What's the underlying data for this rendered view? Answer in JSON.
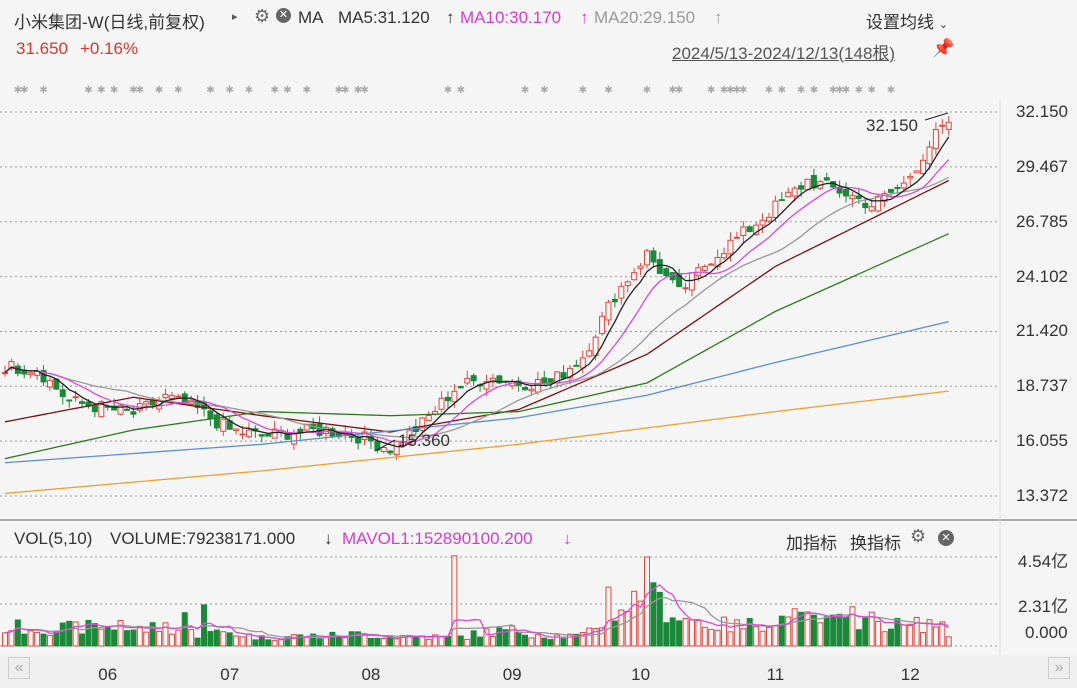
{
  "header": {
    "title": "小米集团-W(日线,前复权)",
    "ma_label": "MA",
    "ma5": "MA5:31.120",
    "ma10": "MA10:30.170",
    "ma20": "MA20:29.150",
    "arrow_up": "↑",
    "settings_ma": "设置均线",
    "price": "31.650",
    "change": "+0.16%",
    "range": "2024/5/13-2024/12/13(148根)"
  },
  "colors": {
    "up": "#e0473e",
    "down": "#1a8a3a",
    "ma5": "#222222",
    "ma10": "#d84ad8",
    "ma20": "#999999",
    "ma30": "#7a1010",
    "ma60": "#2f7a1f",
    "ma120": "#5b8fd6",
    "ma250": "#f0a030",
    "accent": "#d13fcf"
  },
  "volume_panel": {
    "title": "VOL(5,10)",
    "volume": "VOLUME:79238171.000",
    "arrow_down": "↓",
    "mavol": "MAVOL1:152890100.200",
    "add_indicator": "加指标",
    "switch_indicator": "换指标",
    "ticks": [
      "4.54亿",
      "2.31亿",
      "0.000"
    ]
  },
  "annotations": {
    "high": "32.150",
    "low": "15.360"
  },
  "nav": {
    "prev": "«",
    "next": "»"
  },
  "chart_data": {
    "type": "candlestick",
    "count": 148,
    "y_ticks": [
      "32.150",
      "29.467",
      "26.785",
      "24.102",
      "21.420",
      "18.737",
      "16.055",
      "13.372"
    ],
    "ylim": [
      13.372,
      32.15
    ],
    "x_labels": [
      {
        "label": "06",
        "index": 16
      },
      {
        "label": "07",
        "index": 35
      },
      {
        "label": "08",
        "index": 57
      },
      {
        "label": "09",
        "index": 79
      },
      {
        "label": "10",
        "index": 99
      },
      {
        "label": "11",
        "index": 120
      },
      {
        "label": "12",
        "index": 141
      }
    ],
    "close_keypoints": [
      [
        0,
        19.7
      ],
      [
        5,
        19.6
      ],
      [
        10,
        18.0
      ],
      [
        15,
        17.7
      ],
      [
        20,
        17.4
      ],
      [
        25,
        18.2
      ],
      [
        30,
        17.6
      ],
      [
        35,
        16.6
      ],
      [
        40,
        16.3
      ],
      [
        45,
        16.5
      ],
      [
        50,
        16.6
      ],
      [
        55,
        16.3
      ],
      [
        60,
        15.7
      ],
      [
        65,
        16.9
      ],
      [
        70,
        18.6
      ],
      [
        75,
        19.2
      ],
      [
        80,
        18.9
      ],
      [
        85,
        18.9
      ],
      [
        90,
        20.2
      ],
      [
        95,
        23.2
      ],
      [
        100,
        25.2
      ],
      [
        105,
        23.3
      ],
      [
        110,
        25.0
      ],
      [
        115,
        26.2
      ],
      [
        120,
        27.5
      ],
      [
        125,
        28.8
      ],
      [
        130,
        28.3
      ],
      [
        135,
        27.6
      ],
      [
        140,
        28.6
      ],
      [
        145,
        31.0
      ],
      [
        147,
        31.65
      ]
    ],
    "ma_long_keypoints": {
      "ma30": [
        [
          0,
          17.0
        ],
        [
          20,
          18.2
        ],
        [
          40,
          17.3
        ],
        [
          60,
          16.5
        ],
        [
          80,
          17.6
        ],
        [
          100,
          20.3
        ],
        [
          120,
          24.6
        ],
        [
          147,
          28.8
        ]
      ],
      "ma60": [
        [
          0,
          15.2
        ],
        [
          20,
          16.6
        ],
        [
          40,
          17.5
        ],
        [
          60,
          17.3
        ],
        [
          80,
          17.5
        ],
        [
          100,
          18.9
        ],
        [
          120,
          22.4
        ],
        [
          147,
          26.2
        ]
      ],
      "ma120": [
        [
          0,
          15.0
        ],
        [
          40,
          15.9
        ],
        [
          80,
          17.2
        ],
        [
          100,
          18.3
        ],
        [
          120,
          19.9
        ],
        [
          147,
          21.9
        ]
      ],
      "ma250": [
        [
          0,
          13.5
        ],
        [
          40,
          14.6
        ],
        [
          80,
          15.9
        ],
        [
          100,
          16.7
        ],
        [
          120,
          17.5
        ],
        [
          147,
          18.5
        ]
      ]
    },
    "volume_keypoints": [
      [
        0,
        1.0
      ],
      [
        5,
        0.9
      ],
      [
        10,
        0.9
      ],
      [
        15,
        1.0
      ],
      [
        20,
        0.8
      ],
      [
        25,
        1.0
      ],
      [
        30,
        0.6
      ],
      [
        35,
        0.7
      ],
      [
        40,
        0.4
      ],
      [
        45,
        0.5
      ],
      [
        50,
        0.5
      ],
      [
        55,
        0.6
      ],
      [
        60,
        0.5
      ],
      [
        65,
        0.5
      ],
      [
        70,
        0.4
      ],
      [
        75,
        0.7
      ],
      [
        80,
        0.8
      ],
      [
        85,
        0.5
      ],
      [
        90,
        0.5
      ],
      [
        95,
        1.8
      ],
      [
        100,
        2.6
      ],
      [
        105,
        1.5
      ],
      [
        110,
        1.1
      ],
      [
        115,
        1.0
      ],
      [
        120,
        1.4
      ],
      [
        125,
        1.3
      ],
      [
        130,
        1.2
      ],
      [
        135,
        1.3
      ],
      [
        140,
        1.0
      ],
      [
        145,
        1.2
      ],
      [
        147,
        0.6
      ]
    ],
    "volume_spikes": [
      [
        18,
        1.3
      ],
      [
        28,
        1.7
      ],
      [
        31,
        2.1
      ],
      [
        70,
        4.6
      ],
      [
        94,
        3.0
      ],
      [
        100,
        4.54
      ],
      [
        123,
        1.9
      ],
      [
        132,
        2.0
      ]
    ],
    "volume_unit": "亿",
    "vlim": [
      0,
      4.54
    ]
  }
}
